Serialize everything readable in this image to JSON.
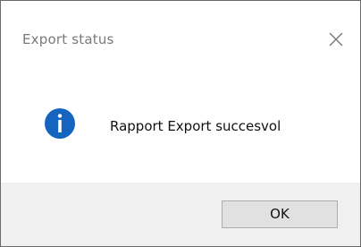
{
  "window": {
    "title": "Export status",
    "close_icon": "close-icon"
  },
  "message": {
    "icon": "info-icon",
    "icon_color": "#1565c0",
    "text": "Rapport Export succesvol"
  },
  "footer": {
    "ok_label": "OK"
  }
}
